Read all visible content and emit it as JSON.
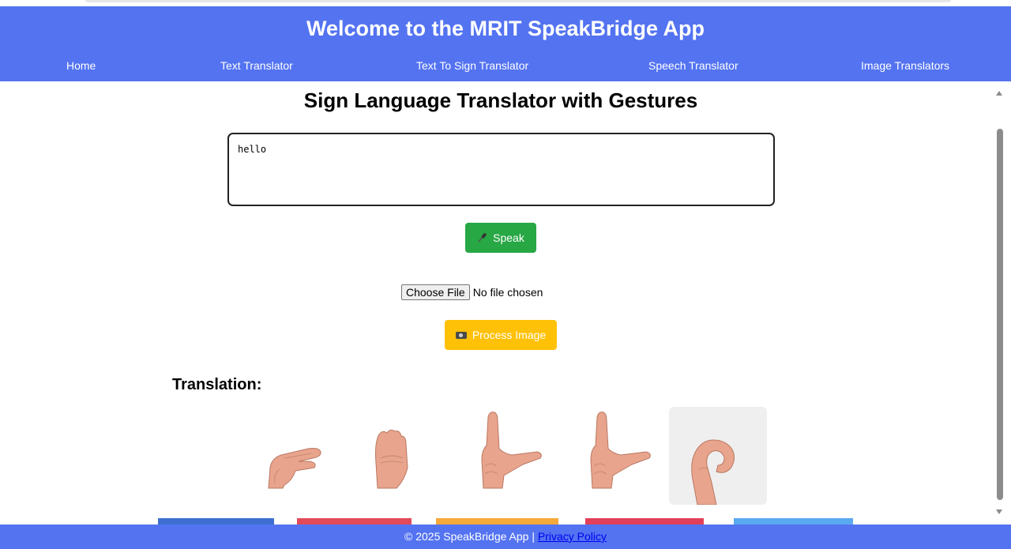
{
  "header": {
    "title": "Welcome to the MRIT SpeakBridge App",
    "nav": [
      "Home",
      "Text Translator",
      "Text To Sign Translator",
      "Speech Translator",
      "Image Translators"
    ]
  },
  "main": {
    "title": "Sign Language Translator with Gestures",
    "input_text": "hello",
    "speak_label": "Speak",
    "speak_icon": "microphone-icon",
    "file_button_label": "Choose File",
    "file_status": "No file chosen",
    "process_label": "Process Image",
    "process_icon": "camera-icon",
    "translation_label": "Translation:"
  },
  "footer": {
    "text": "© 2025 SpeakBridge App | ",
    "link": "Privacy Policy"
  },
  "colors": {
    "brand": "#5373f1",
    "speak": "#28a745",
    "process": "#ffc107"
  }
}
